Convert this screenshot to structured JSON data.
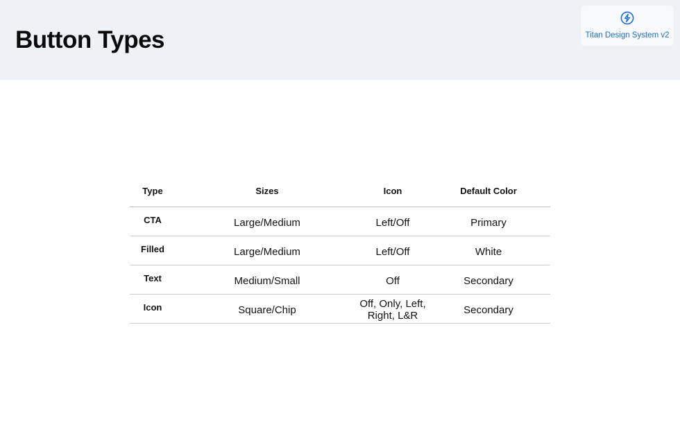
{
  "header": {
    "title": "Button Types",
    "brand": {
      "name": "Titan Design System v2",
      "icon": "bolt-circle-icon",
      "color": "#1d6fd1"
    }
  },
  "table": {
    "columns": [
      "Type",
      "Sizes",
      "Icon",
      "Default Color"
    ],
    "rows": [
      {
        "type": "CTA",
        "sizes": "Large/Medium",
        "icon": "Left/Off",
        "color": "Primary"
      },
      {
        "type": "Filled",
        "sizes": "Large/Medium",
        "icon": "Left/Off",
        "color": "White"
      },
      {
        "type": "Text",
        "sizes": "Medium/Small",
        "icon": "Off",
        "color": "Secondary"
      },
      {
        "type": "Icon",
        "sizes": "Square/Chip",
        "icon": "Off, Only, Left, Right, L&R",
        "color": "Secondary"
      }
    ]
  }
}
